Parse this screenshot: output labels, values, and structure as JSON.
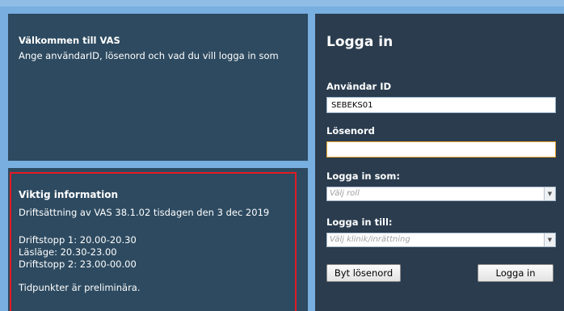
{
  "welcome": {
    "title": "Välkommen till VAS",
    "text": "Ange användarID, lösenord och vad du vill logga in som"
  },
  "info": {
    "title": "Viktig information",
    "lines": [
      "Driftsättning av VAS 38.1.02 tisdagen den 3 dec 2019",
      "Driftstopp 1: 20.00-20.30",
      "Läsläge: 20.30-23.00",
      "Driftstopp 2: 23.00-00.00",
      "Tidpunkter är preliminära."
    ]
  },
  "login": {
    "title": "Logga in",
    "user_label": "Användar ID",
    "user_value": "SEBEKS01",
    "password_label": "Lösenord",
    "role_label": "Logga in som:",
    "role_placeholder": "Välj roll",
    "clinic_label": "Logga in till:",
    "clinic_placeholder": "Välj klinik/inrättning",
    "change_password_button": "Byt lösenord",
    "login_button": "Logga in"
  },
  "colors": {
    "page_background": "#78aee0",
    "panel": "#2d4a60",
    "login_panel": "#2a3c4e",
    "highlight_border": "#e21b23",
    "focus_border": "#f0a630"
  }
}
